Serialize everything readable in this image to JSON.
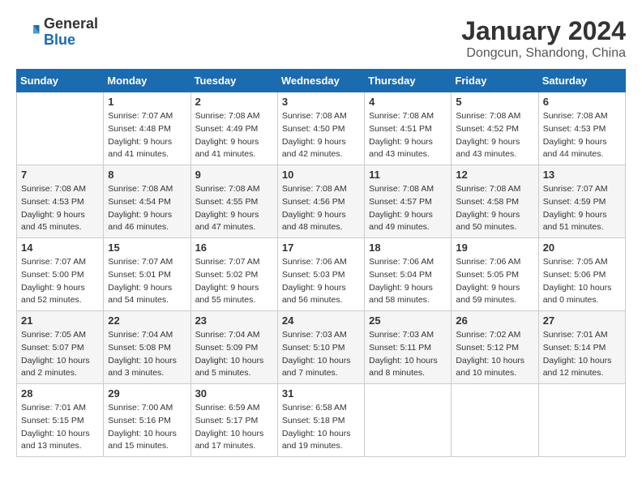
{
  "header": {
    "logo_general": "General",
    "logo_blue": "Blue",
    "month_year": "January 2024",
    "location": "Dongcun, Shandong, China"
  },
  "weekdays": [
    "Sunday",
    "Monday",
    "Tuesday",
    "Wednesday",
    "Thursday",
    "Friday",
    "Saturday"
  ],
  "weeks": [
    [
      {
        "day": "",
        "info": ""
      },
      {
        "day": "1",
        "info": "Sunrise: 7:07 AM\nSunset: 4:48 PM\nDaylight: 9 hours\nand 41 minutes."
      },
      {
        "day": "2",
        "info": "Sunrise: 7:08 AM\nSunset: 4:49 PM\nDaylight: 9 hours\nand 41 minutes."
      },
      {
        "day": "3",
        "info": "Sunrise: 7:08 AM\nSunset: 4:50 PM\nDaylight: 9 hours\nand 42 minutes."
      },
      {
        "day": "4",
        "info": "Sunrise: 7:08 AM\nSunset: 4:51 PM\nDaylight: 9 hours\nand 43 minutes."
      },
      {
        "day": "5",
        "info": "Sunrise: 7:08 AM\nSunset: 4:52 PM\nDaylight: 9 hours\nand 43 minutes."
      },
      {
        "day": "6",
        "info": "Sunrise: 7:08 AM\nSunset: 4:53 PM\nDaylight: 9 hours\nand 44 minutes."
      }
    ],
    [
      {
        "day": "7",
        "info": "Sunrise: 7:08 AM\nSunset: 4:53 PM\nDaylight: 9 hours\nand 45 minutes."
      },
      {
        "day": "8",
        "info": "Sunrise: 7:08 AM\nSunset: 4:54 PM\nDaylight: 9 hours\nand 46 minutes."
      },
      {
        "day": "9",
        "info": "Sunrise: 7:08 AM\nSunset: 4:55 PM\nDaylight: 9 hours\nand 47 minutes."
      },
      {
        "day": "10",
        "info": "Sunrise: 7:08 AM\nSunset: 4:56 PM\nDaylight: 9 hours\nand 48 minutes."
      },
      {
        "day": "11",
        "info": "Sunrise: 7:08 AM\nSunset: 4:57 PM\nDaylight: 9 hours\nand 49 minutes."
      },
      {
        "day": "12",
        "info": "Sunrise: 7:08 AM\nSunset: 4:58 PM\nDaylight: 9 hours\nand 50 minutes."
      },
      {
        "day": "13",
        "info": "Sunrise: 7:07 AM\nSunset: 4:59 PM\nDaylight: 9 hours\nand 51 minutes."
      }
    ],
    [
      {
        "day": "14",
        "info": "Sunrise: 7:07 AM\nSunset: 5:00 PM\nDaylight: 9 hours\nand 52 minutes."
      },
      {
        "day": "15",
        "info": "Sunrise: 7:07 AM\nSunset: 5:01 PM\nDaylight: 9 hours\nand 54 minutes."
      },
      {
        "day": "16",
        "info": "Sunrise: 7:07 AM\nSunset: 5:02 PM\nDaylight: 9 hours\nand 55 minutes."
      },
      {
        "day": "17",
        "info": "Sunrise: 7:06 AM\nSunset: 5:03 PM\nDaylight: 9 hours\nand 56 minutes."
      },
      {
        "day": "18",
        "info": "Sunrise: 7:06 AM\nSunset: 5:04 PM\nDaylight: 9 hours\nand 58 minutes."
      },
      {
        "day": "19",
        "info": "Sunrise: 7:06 AM\nSunset: 5:05 PM\nDaylight: 9 hours\nand 59 minutes."
      },
      {
        "day": "20",
        "info": "Sunrise: 7:05 AM\nSunset: 5:06 PM\nDaylight: 10 hours\nand 0 minutes."
      }
    ],
    [
      {
        "day": "21",
        "info": "Sunrise: 7:05 AM\nSunset: 5:07 PM\nDaylight: 10 hours\nand 2 minutes."
      },
      {
        "day": "22",
        "info": "Sunrise: 7:04 AM\nSunset: 5:08 PM\nDaylight: 10 hours\nand 3 minutes."
      },
      {
        "day": "23",
        "info": "Sunrise: 7:04 AM\nSunset: 5:09 PM\nDaylight: 10 hours\nand 5 minutes."
      },
      {
        "day": "24",
        "info": "Sunrise: 7:03 AM\nSunset: 5:10 PM\nDaylight: 10 hours\nand 7 minutes."
      },
      {
        "day": "25",
        "info": "Sunrise: 7:03 AM\nSunset: 5:11 PM\nDaylight: 10 hours\nand 8 minutes."
      },
      {
        "day": "26",
        "info": "Sunrise: 7:02 AM\nSunset: 5:12 PM\nDaylight: 10 hours\nand 10 minutes."
      },
      {
        "day": "27",
        "info": "Sunrise: 7:01 AM\nSunset: 5:14 PM\nDaylight: 10 hours\nand 12 minutes."
      }
    ],
    [
      {
        "day": "28",
        "info": "Sunrise: 7:01 AM\nSunset: 5:15 PM\nDaylight: 10 hours\nand 13 minutes."
      },
      {
        "day": "29",
        "info": "Sunrise: 7:00 AM\nSunset: 5:16 PM\nDaylight: 10 hours\nand 15 minutes."
      },
      {
        "day": "30",
        "info": "Sunrise: 6:59 AM\nSunset: 5:17 PM\nDaylight: 10 hours\nand 17 minutes."
      },
      {
        "day": "31",
        "info": "Sunrise: 6:58 AM\nSunset: 5:18 PM\nDaylight: 10 hours\nand 19 minutes."
      },
      {
        "day": "",
        "info": ""
      },
      {
        "day": "",
        "info": ""
      },
      {
        "day": "",
        "info": ""
      }
    ]
  ]
}
